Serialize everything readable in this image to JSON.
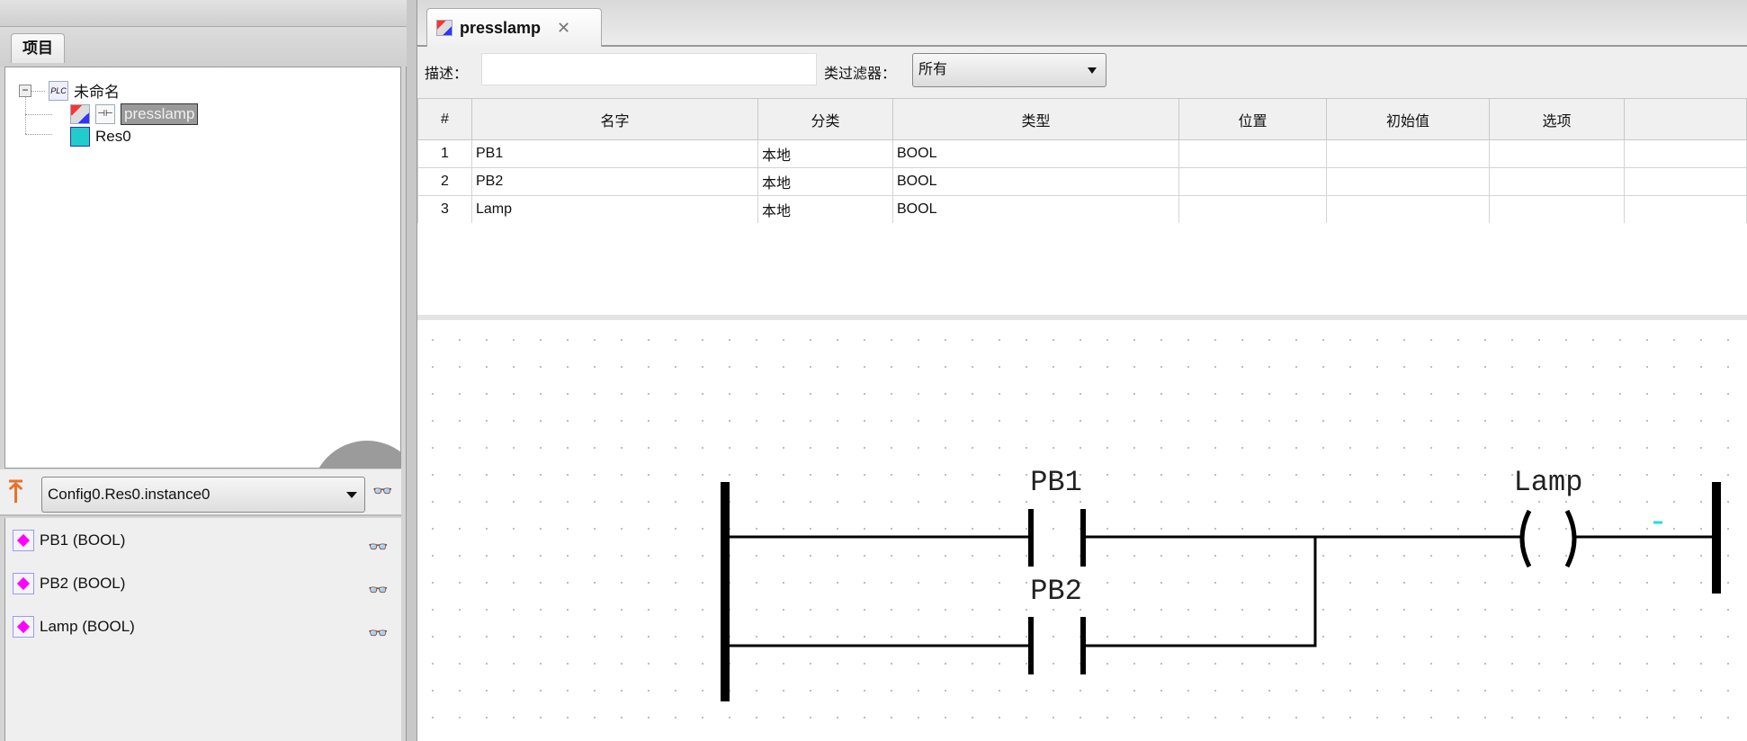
{
  "project_panel": {
    "tab": "项目",
    "tree": {
      "root": "未命名",
      "children": [
        "presslamp",
        "Res0"
      ]
    }
  },
  "debug": {
    "instance": "Config0.Res0.instance0",
    "variables": [
      "PB1 (BOOL)",
      "PB2 (BOOL)",
      "Lamp (BOOL)"
    ]
  },
  "editor": {
    "tab_label": "presslamp",
    "close": "✕",
    "filter": {
      "desc_label": "描述：",
      "desc_value": "",
      "class_label": "类过滤器：",
      "class_value": "所有"
    },
    "table": {
      "headers": [
        "#",
        "名字",
        "分类",
        "类型",
        "位置",
        "初始值",
        "选项",
        ""
      ],
      "rows": [
        [
          "1",
          "PB1",
          "本地",
          "BOOL",
          "",
          "",
          ""
        ],
        [
          "2",
          "PB2",
          "本地",
          "BOOL",
          "",
          "",
          ""
        ],
        [
          "3",
          "Lamp",
          "本地",
          "BOOL",
          "",
          "",
          ""
        ]
      ]
    },
    "ladder": {
      "contacts": [
        "PB1",
        "PB2"
      ],
      "coil": "Lamp"
    }
  },
  "icons": {
    "glasses": "👓"
  }
}
